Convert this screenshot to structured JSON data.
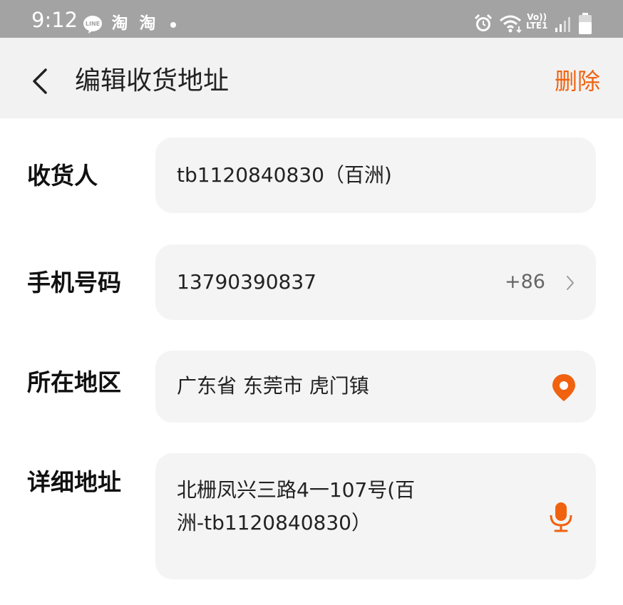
{
  "status_bar": {
    "time": "9:12",
    "app_icons": [
      "line-icon",
      "taobao-icon",
      "taobao-icon"
    ],
    "taobao_glyph": "淘",
    "network_label_top": "Vo))",
    "network_label_bottom": "LTE1"
  },
  "header": {
    "title": "编辑收货地址",
    "delete_label": "删除"
  },
  "form": {
    "recipient": {
      "label": "收货人",
      "value": "tb1120840830（百洲)"
    },
    "phone": {
      "label": "手机号码",
      "value": "13790390837",
      "country_code": "+86"
    },
    "region": {
      "label": "所在地区",
      "value": "广东省 东莞市 虎门镇"
    },
    "address": {
      "label": "详细地址",
      "line1": "北栅凤兴三路4一107号(百",
      "line2": "洲-tb1120840830）"
    }
  },
  "colors": {
    "accent": "#f0620f",
    "status_bar": "#a3a3a3",
    "header_bg": "#f2f2f2",
    "field_bg": "#f4f4f4"
  }
}
